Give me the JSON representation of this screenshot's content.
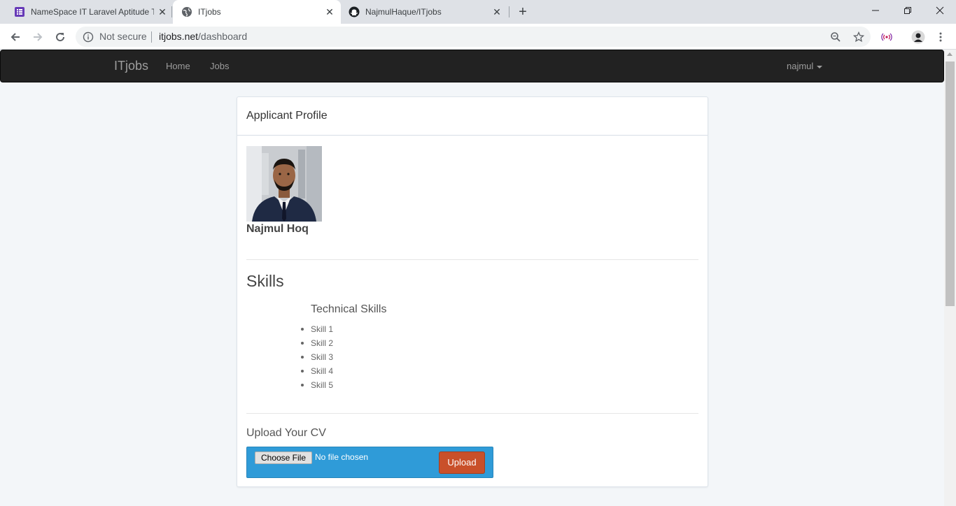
{
  "browser": {
    "tabs": [
      {
        "title": "NameSpace IT Laravel Aptitude T",
        "icon": "form-icon"
      },
      {
        "title": "ITjobs",
        "icon": "globe-icon"
      },
      {
        "title": "NajmulHaque/ITjobs",
        "icon": "github-icon"
      }
    ],
    "address": {
      "security": "Not secure",
      "host": "itjobs.net",
      "path": "/dashboard"
    }
  },
  "site": {
    "brand": "ITjobs",
    "nav": [
      {
        "label": "Home"
      },
      {
        "label": "Jobs"
      }
    ],
    "user": "najmul"
  },
  "profile": {
    "panel_title": "Applicant Profile",
    "name": "Najmul Hoq",
    "skills_heading": "Skills",
    "technical_heading": "Technical Skills",
    "skills": [
      "Skill 1",
      "Skill 2",
      "Skill 3",
      "Skill 4",
      "Skill 5"
    ],
    "cv_heading": "Upload Your CV",
    "choose_file_label": "Choose File",
    "no_file_text": "No file chosen",
    "upload_label": "Upload"
  },
  "colors": {
    "navbar": "#222222",
    "upload_box": "#2f9bd8",
    "upload_button": "#c9502a"
  }
}
